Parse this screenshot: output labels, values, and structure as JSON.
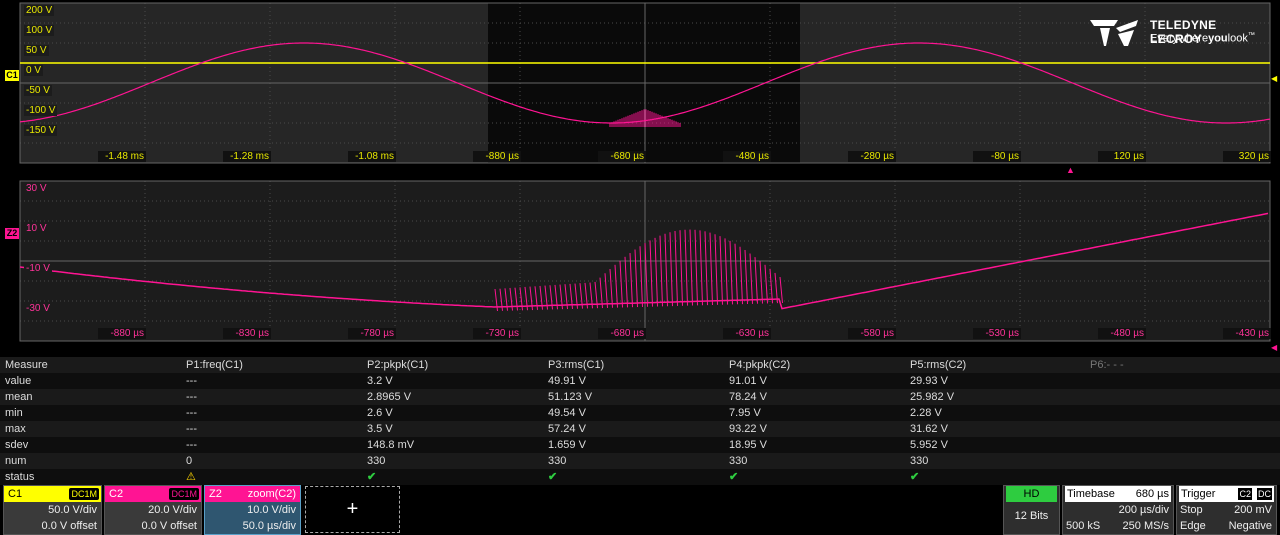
{
  "top_grid": {
    "volt_labels": [
      "200 V",
      "100 V",
      "50 V",
      "0 V",
      "-50 V",
      "-100 V",
      "-150 V"
    ],
    "time_labels": [
      "-1.48 ms",
      "-1.28 ms",
      "-1.08 ms",
      "-880 µs",
      "-680 µs",
      "-480 µs",
      "-280 µs",
      "-80 µs",
      "120 µs",
      "320 µs"
    ],
    "channel_marker": "C1",
    "trigger_level_marker": "T"
  },
  "zoom_grid": {
    "volt_labels": [
      "30 V",
      "10 V",
      "-10 V",
      "-30 V"
    ],
    "time_labels": [
      "-880 µs",
      "-830 µs",
      "-780 µs",
      "-730 µs",
      "-680 µs",
      "-630 µs",
      "-580 µs",
      "-530 µs",
      "-480 µs",
      "-430 µs"
    ],
    "channel_marker": "Z2"
  },
  "logo": {
    "brand": "TELEDYNE LECROY",
    "tagline_pre": "Everywhere",
    "tagline_bold": "you",
    "tagline_post": "look",
    "tm": "™"
  },
  "measure": {
    "headers": [
      "Measure",
      "P1:freq(C1)",
      "P2:pkpk(C1)",
      "P3:rms(C1)",
      "P4:pkpk(C2)",
      "P5:rms(C2)",
      "P6:- - -"
    ],
    "rows": [
      [
        "value",
        "---",
        "3.2 V",
        "49.91 V",
        "91.01 V",
        "29.93 V"
      ],
      [
        "mean",
        "---",
        "2.8965 V",
        "51.123 V",
        "78.24 V",
        "25.982 V"
      ],
      [
        "min",
        "---",
        "2.6 V",
        "49.54 V",
        "7.95 V",
        "2.28 V"
      ],
      [
        "max",
        "---",
        "3.5 V",
        "57.24 V",
        "93.22 V",
        "31.62 V"
      ],
      [
        "sdev",
        "---",
        "148.8 mV",
        "1.659 V",
        "18.95 V",
        "5.952 V"
      ],
      [
        "num",
        "0",
        "330",
        "330",
        "330",
        "330"
      ],
      [
        "status",
        "⚠",
        "✔",
        "✔",
        "✔",
        "✔"
      ]
    ]
  },
  "dock": {
    "c1": {
      "name": "C1",
      "coupling": "DC1M",
      "vdiv": "50.0 V/div",
      "offset": "0.0 V offset",
      "color": "#ffff00"
    },
    "c2": {
      "name": "C2",
      "coupling": "DC1M",
      "vdiv": "20.0 V/div",
      "offset": "0.0 V offset",
      "color": "#ff1493"
    },
    "z2": {
      "name": "Z2",
      "mode": "zoom(C2)",
      "vdiv": "10.0 V/div",
      "tdiv": "50.0 µs/div"
    },
    "add": "+",
    "hd": {
      "label": "HD",
      "bits": "12 Bits"
    },
    "timebase": {
      "label": "Timebase",
      "delay": "680 µs",
      "tdiv": "200 µs/div",
      "samples": "500 kS",
      "rate": "250 MS/s"
    },
    "trigger": {
      "label": "Trigger",
      "source": "C2",
      "coupling": "DC",
      "mode": "Stop",
      "level": "200 mV",
      "type": "Edge",
      "slope": "Negative"
    }
  },
  "colors": {
    "c1": "#ffff00",
    "c2": "#ff1493",
    "grid": "#555555"
  }
}
